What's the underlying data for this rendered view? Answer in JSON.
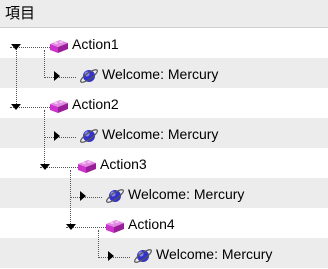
{
  "header": {
    "title": "項目"
  },
  "tree": {
    "nodes": [
      {
        "label": "Action1",
        "type": "action",
        "expanded": true
      },
      {
        "label": "Welcome: Mercury",
        "type": "page",
        "expanded": false
      },
      {
        "label": "Action2",
        "type": "action",
        "expanded": true
      },
      {
        "label": "Welcome: Mercury",
        "type": "page",
        "expanded": false
      },
      {
        "label": "Action3",
        "type": "action",
        "expanded": true
      },
      {
        "label": "Welcome: Mercury",
        "type": "page",
        "expanded": false
      },
      {
        "label": "Action4",
        "type": "action",
        "expanded": true
      },
      {
        "label": "Welcome: Mercury",
        "type": "page",
        "expanded": false
      }
    ]
  },
  "icons": {
    "action": "action-block-icon",
    "page": "planet-orbit-icon"
  },
  "colors": {
    "action_icon": "#cc33cc",
    "page_icon": "#3333cc",
    "row_alt": "#ececec"
  }
}
